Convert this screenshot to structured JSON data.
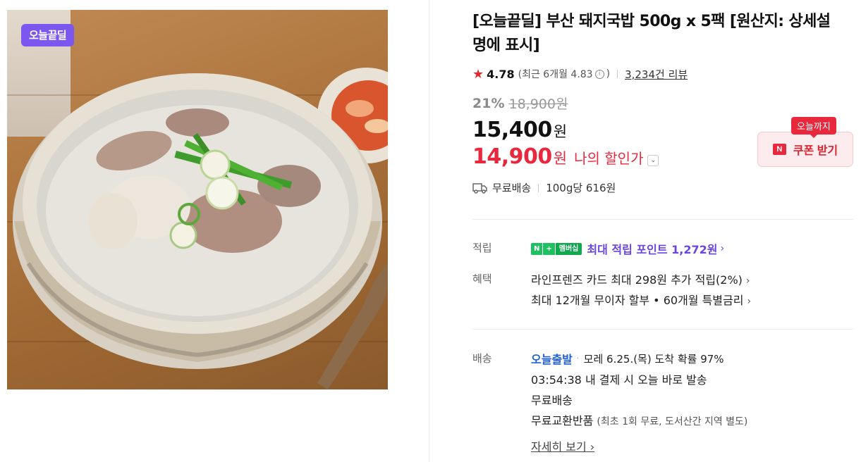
{
  "image": {
    "badge": "오늘끝딜",
    "alt": "돼지국밥 상품 이미지"
  },
  "product": {
    "title": "[오늘끝딜] 부산 돼지국밥 500g x 5팩 [원산지: 상세설명에 표시]",
    "rating": "4.78",
    "recent_rating": "(최근 6개월 4.83",
    "recent_close": ")",
    "info_icon": "i",
    "reviews": "3,234건 리뷰"
  },
  "pricing": {
    "discount_rate": "21%",
    "original_price": "18,900원",
    "price": "15,400",
    "price_unit": "원",
    "my_price": "14,900",
    "my_price_unit": "원",
    "my_price_label": "나의 할인가",
    "dropdown_icon": "chevron-down"
  },
  "coupon": {
    "tag": "오늘까지",
    "logo": "N",
    "button_label": "쿠폰 받기"
  },
  "shipping_summary": {
    "label": "무료배송",
    "unit_price": "100g당 616원"
  },
  "points": {
    "label": "적립",
    "badge_n": "N",
    "badge_plus": "+",
    "badge_member": "멤버십",
    "text": "최대 적립 포인트 1,272원"
  },
  "benefits": {
    "label": "혜택",
    "items": [
      "라인프렌즈 카드 최대 298원 추가 적립(2%)",
      "최대 12개월 무이자 할부 • 60개월 특별금리"
    ]
  },
  "delivery": {
    "label": "배송",
    "today_ship": "오늘출발",
    "eta": "모레 6.25.(목) 도착 확률 97%",
    "countdown": "03:54:38  내 결제 시 오늘 바로 발송",
    "free": "무료배송",
    "exchange": "무료교환반품",
    "exchange_note": "(최초 1회 무료, 도서산간 지역 별도)",
    "more": "자세히 보기"
  },
  "colors": {
    "accent_red": "#e8283c",
    "points_purple": "#6b45e0",
    "ship_blue": "#1f5fd8",
    "badge_purple": "#7b57f0"
  }
}
